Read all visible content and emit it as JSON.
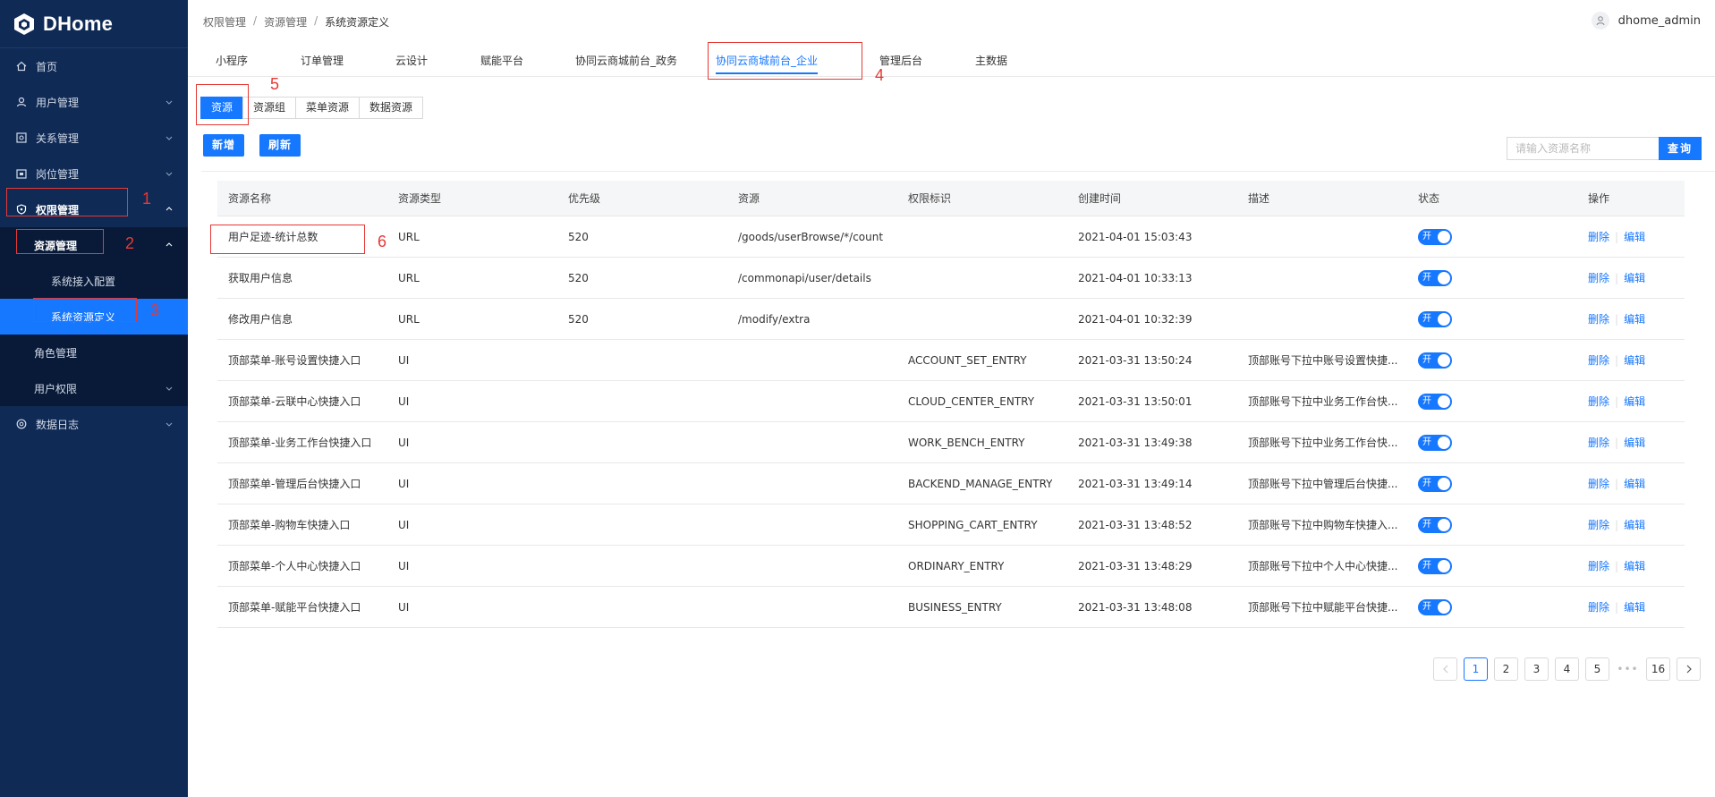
{
  "app": {
    "name": "DHome",
    "user": "dhome_admin"
  },
  "sidebar": {
    "items": [
      {
        "label": "首页",
        "icon": "home-icon"
      },
      {
        "label": "用户管理",
        "icon": "user-icon"
      },
      {
        "label": "关系管理",
        "icon": "relation-icon"
      },
      {
        "label": "岗位管理",
        "icon": "post-icon"
      },
      {
        "label": "权限管理",
        "icon": "shield-icon"
      }
    ],
    "permission_sub": [
      {
        "label": "资源管理"
      }
    ],
    "resource_sub": [
      {
        "label": "系统接入配置"
      },
      {
        "label": "系统资源定义"
      }
    ],
    "more": [
      {
        "label": "角色管理"
      },
      {
        "label": "用户权限"
      }
    ],
    "log": {
      "label": "数据日志",
      "icon": "log-icon"
    }
  },
  "breadcrumb": [
    "权限管理",
    "资源管理",
    "系统资源定义"
  ],
  "tabs": [
    "小程序",
    "订单管理",
    "云设计",
    "赋能平台",
    "协同云商城前台_政务",
    "协同云商城前台_企业",
    "管理后台",
    "主数据"
  ],
  "subtabs": [
    "资源",
    "资源组",
    "菜单资源",
    "数据资源"
  ],
  "toolbar": {
    "add": "新增",
    "refresh": "刷新",
    "search_placeholder": "请输入资源名称",
    "search_btn": "查询"
  },
  "table": {
    "headers": [
      "资源名称",
      "资源类型",
      "优先级",
      "资源",
      "权限标识",
      "创建时间",
      "描述",
      "状态",
      "操作"
    ],
    "rows": [
      [
        "用户足迹-统计总数",
        "URL",
        "520",
        "/goods/userBrowse/*/count",
        "",
        "2021-04-01 15:03:43",
        ""
      ],
      [
        "获取用户信息",
        "URL",
        "520",
        "/commonapi/user/details",
        "",
        "2021-04-01 10:33:13",
        ""
      ],
      [
        "修改用户信息",
        "URL",
        "520",
        "/modify/extra",
        "",
        "2021-04-01 10:32:39",
        ""
      ],
      [
        "顶部菜单-账号设置快捷入口",
        "UI",
        "",
        "",
        "ACCOUNT_SET_ENTRY",
        "2021-03-31 13:50:24",
        "顶部账号下拉中账号设置快捷..."
      ],
      [
        "顶部菜单-云联中心快捷入口",
        "UI",
        "",
        "",
        "CLOUD_CENTER_ENTRY",
        "2021-03-31 13:50:01",
        "顶部账号下拉中业务工作台快..."
      ],
      [
        "顶部菜单-业务工作台快捷入口",
        "UI",
        "",
        "",
        "WORK_BENCH_ENTRY",
        "2021-03-31 13:49:38",
        "顶部账号下拉中业务工作台快..."
      ],
      [
        "顶部菜单-管理后台快捷入口",
        "UI",
        "",
        "",
        "BACKEND_MANAGE_ENTRY",
        "2021-03-31 13:49:14",
        "顶部账号下拉中管理后台快捷..."
      ],
      [
        "顶部菜单-购物车快捷入口",
        "UI",
        "",
        "",
        "SHOPPING_CART_ENTRY",
        "2021-03-31 13:48:52",
        "顶部账号下拉中购物车快捷入..."
      ],
      [
        "顶部菜单-个人中心快捷入口",
        "UI",
        "",
        "",
        "ORDINARY_ENTRY",
        "2021-03-31 13:48:29",
        "顶部账号下拉中个人中心快捷..."
      ],
      [
        "顶部菜单-赋能平台快捷入口",
        "UI",
        "",
        "",
        "BUSINESS_ENTRY",
        "2021-03-31 13:48:08",
        "顶部账号下拉中赋能平台快捷..."
      ]
    ],
    "toggle_label": "开",
    "action_delete": "删除",
    "action_edit": "编辑"
  },
  "pager": {
    "pages": [
      "1",
      "2",
      "3",
      "4",
      "5",
      "16"
    ],
    "current": "1",
    "ellipsis": "•••"
  },
  "annotations": [
    "1",
    "2",
    "3",
    "4",
    "5",
    "6"
  ],
  "colors": {
    "sidebar": "#0f2a55",
    "accent": "#1677ff",
    "annotation": "#e53935"
  }
}
